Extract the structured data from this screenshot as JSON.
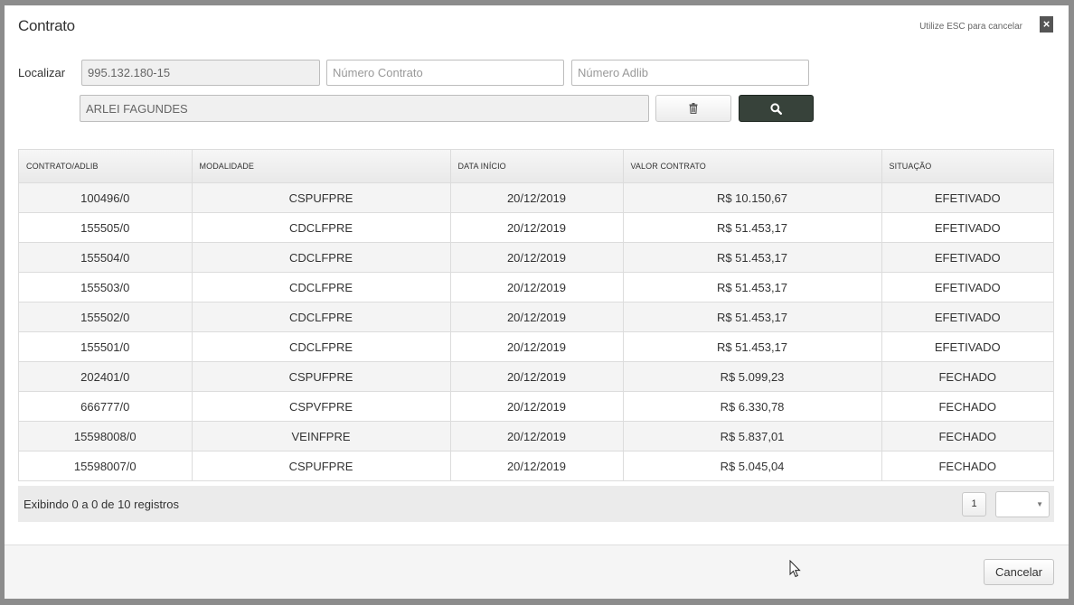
{
  "modal": {
    "title": "Contrato",
    "esc_hint": "Utilize ESC para cancelar",
    "close_label": "×"
  },
  "search": {
    "label": "Localizar",
    "cpf_value": "995.132.180-15",
    "contract_placeholder": "Número Contrato",
    "adlib_placeholder": "Número Adlib",
    "name_value": "ARLEI FAGUNDES"
  },
  "icons": {
    "clear": "trash-icon",
    "search": "search-icon",
    "close": "close-icon"
  },
  "colors": {
    "search_button": "#37423a",
    "row_alt": "#f4f4f4"
  },
  "table": {
    "headers": [
      "CONTRATO/ADLIB",
      "MODALIDADE",
      "DATA INÍCIO",
      "VALOR CONTRATO",
      "SITUAÇÃO"
    ],
    "rows": [
      [
        "100496/0",
        "CSPUFPRE",
        "20/12/2019",
        "R$ 10.150,67",
        "EFETIVADO"
      ],
      [
        "155505/0",
        "CDCLFPRE",
        "20/12/2019",
        "R$ 51.453,17",
        "EFETIVADO"
      ],
      [
        "155504/0",
        "CDCLFPRE",
        "20/12/2019",
        "R$ 51.453,17",
        "EFETIVADO"
      ],
      [
        "155503/0",
        "CDCLFPRE",
        "20/12/2019",
        "R$ 51.453,17",
        "EFETIVADO"
      ],
      [
        "155502/0",
        "CDCLFPRE",
        "20/12/2019",
        "R$ 51.453,17",
        "EFETIVADO"
      ],
      [
        "155501/0",
        "CDCLFPRE",
        "20/12/2019",
        "R$ 51.453,17",
        "EFETIVADO"
      ],
      [
        "202401/0",
        "CSPUFPRE",
        "20/12/2019",
        "R$ 5.099,23",
        "FECHADO"
      ],
      [
        "666777/0",
        "CSPVFPRE",
        "20/12/2019",
        "R$ 6.330,78",
        "FECHADO"
      ],
      [
        "15598008/0",
        "VEINFPRE",
        "20/12/2019",
        "R$ 5.837,01",
        "FECHADO"
      ],
      [
        "15598007/0",
        "CSPUFPRE",
        "20/12/2019",
        "R$ 5.045,04",
        "FECHADO"
      ]
    ]
  },
  "pagination": {
    "info": "Exibindo 0 a 0 de 10 registros",
    "current_page": "1",
    "page_size_value": ""
  },
  "footer": {
    "cancel_label": "Cancelar"
  }
}
